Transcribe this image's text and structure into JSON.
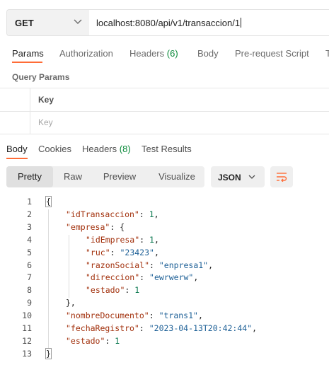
{
  "request": {
    "method": "GET",
    "url": "localhost:8080/api/v1/transaccion/1"
  },
  "request_tabs": [
    {
      "label": "Params",
      "count": ""
    },
    {
      "label": "Authorization",
      "count": ""
    },
    {
      "label": "Headers",
      "count": "(6)"
    },
    {
      "label": "Body",
      "count": ""
    },
    {
      "label": "Pre-request Script",
      "count": ""
    },
    {
      "label": "T",
      "count": ""
    }
  ],
  "query_params": {
    "title": "Query Params",
    "key_header": "Key",
    "key_placeholder": "Key"
  },
  "response_tabs": [
    {
      "label": "Body",
      "count": ""
    },
    {
      "label": "Cookies",
      "count": ""
    },
    {
      "label": "Headers",
      "count": "(8)"
    },
    {
      "label": "Test Results",
      "count": ""
    }
  ],
  "view_modes": [
    "Pretty",
    "Raw",
    "Preview",
    "Visualize"
  ],
  "format": "JSON",
  "icons": {
    "method_dropdown": "chevron-down-icon",
    "format_dropdown": "chevron-down-icon",
    "wrap": "wrap-lines-icon"
  },
  "colors": {
    "accent": "#ff6c37",
    "json_key": "#a2310d",
    "json_string": "#1c5f96",
    "json_number": "#0e7a52",
    "count_green": "#0a8a3a"
  },
  "response_lines": [
    {
      "num": "1",
      "indent": 0,
      "key": "",
      "sep": "",
      "value": "",
      "vtype": "",
      "end": "{"
    },
    {
      "num": "2",
      "indent": 1,
      "key": "\"idTransaccion\"",
      "sep": ": ",
      "value": "1",
      "vtype": "n",
      "end": ","
    },
    {
      "num": "3",
      "indent": 1,
      "key": "\"empresa\"",
      "sep": ": ",
      "value": "",
      "vtype": "",
      "end": "{"
    },
    {
      "num": "4",
      "indent": 2,
      "key": "\"idEmpresa\"",
      "sep": ": ",
      "value": "1",
      "vtype": "n",
      "end": ","
    },
    {
      "num": "5",
      "indent": 2,
      "key": "\"ruc\"",
      "sep": ": ",
      "value": "\"23423\"",
      "vtype": "s",
      "end": ","
    },
    {
      "num": "6",
      "indent": 2,
      "key": "\"razonSocial\"",
      "sep": ": ",
      "value": "\"enpresa1\"",
      "vtype": "s",
      "end": ","
    },
    {
      "num": "7",
      "indent": 2,
      "key": "\"direccion\"",
      "sep": ": ",
      "value": "\"ewrwerw\"",
      "vtype": "s",
      "end": ","
    },
    {
      "num": "8",
      "indent": 2,
      "key": "\"estado\"",
      "sep": ": ",
      "value": "1",
      "vtype": "n",
      "end": ""
    },
    {
      "num": "9",
      "indent": 1,
      "key": "",
      "sep": "",
      "value": "",
      "vtype": "",
      "end": "},"
    },
    {
      "num": "10",
      "indent": 1,
      "key": "\"nombreDocumento\"",
      "sep": ": ",
      "value": "\"trans1\"",
      "vtype": "s",
      "end": ","
    },
    {
      "num": "11",
      "indent": 1,
      "key": "\"fechaRegistro\"",
      "sep": ": ",
      "value": "\"2023-04-13T20:42:44\"",
      "vtype": "s",
      "end": ","
    },
    {
      "num": "12",
      "indent": 1,
      "key": "\"estado\"",
      "sep": ": ",
      "value": "1",
      "vtype": "n",
      "end": ""
    },
    {
      "num": "13",
      "indent": 0,
      "key": "",
      "sep": "",
      "value": "",
      "vtype": "",
      "end": "}"
    }
  ]
}
